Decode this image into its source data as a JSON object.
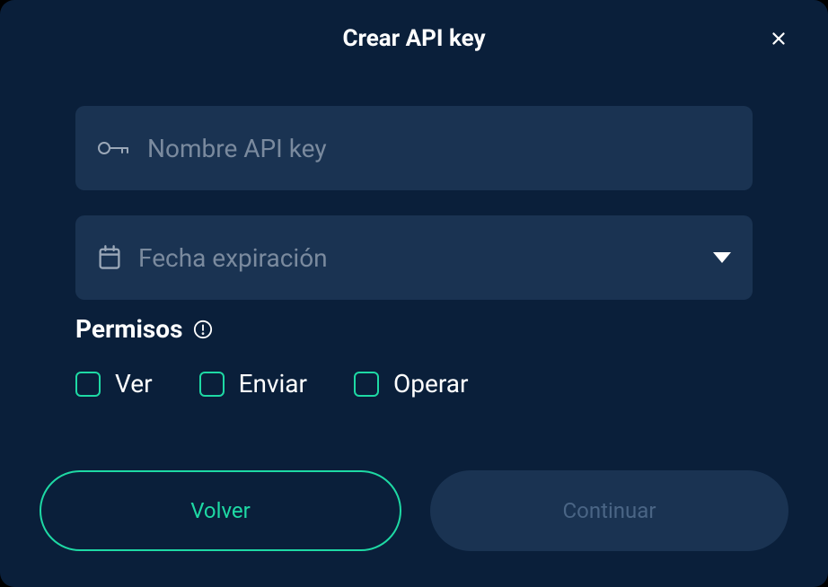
{
  "modal": {
    "title": "Crear API key"
  },
  "fields": {
    "nameField": {
      "placeholder": "Nombre API key"
    },
    "expirationField": {
      "placeholder": "Fecha expiración"
    }
  },
  "permissions": {
    "title": "Permisos",
    "options": {
      "view": "Ver",
      "send": "Enviar",
      "operate": "Operar"
    }
  },
  "buttons": {
    "back": "Volver",
    "continue": "Continuar"
  }
}
